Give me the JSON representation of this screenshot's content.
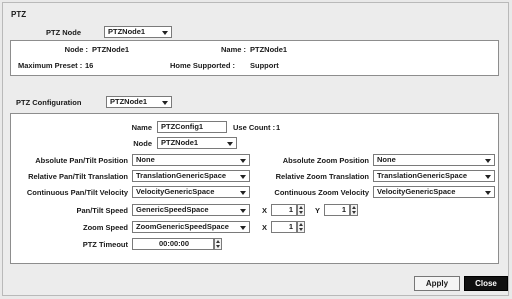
{
  "title": "PTZ",
  "node_select": {
    "label": "PTZ Node",
    "value": "PTZNode1"
  },
  "info": {
    "node_label": "Node :",
    "node_value": "PTZNode1",
    "name_label": "Name :",
    "name_value": "PTZNode1",
    "max_preset_label": "Maximum Preset :",
    "max_preset_value": "16",
    "home_label": "Home Supported :",
    "home_value": "Support"
  },
  "config_select": {
    "label": "PTZ Configuration",
    "value": "PTZNode1"
  },
  "config": {
    "name_label": "Name",
    "name_value": "PTZConfig1",
    "use_count_label": "Use Count :",
    "use_count_value": "1",
    "node_label": "Node",
    "node_value": "PTZNode1",
    "abs_pt_label": "Absolute Pan/Tilt Position",
    "abs_pt_value": "None",
    "abs_zoom_label": "Absolute Zoom Position",
    "abs_zoom_value": "None",
    "rel_pt_label": "Relative Pan/Tilt Translation",
    "rel_pt_value": "TranslationGenericSpace",
    "rel_zoom_label": "Relative Zoom Translation",
    "rel_zoom_value": "TranslationGenericSpace",
    "cont_pt_label": "Continuous Pan/Tilt Velocity",
    "cont_pt_value": "VelocityGenericSpace",
    "cont_zoom_label": "Continuous Zoom Velocity",
    "cont_zoom_value": "VelocityGenericSpace",
    "pt_speed_label": "Pan/Tilt Speed",
    "pt_speed_value": "GenericSpeedSpace",
    "pt_x_label": "X",
    "pt_x_value": "1",
    "pt_y_label": "Y",
    "pt_y_value": "1",
    "zoom_speed_label": "Zoom Speed",
    "zoom_speed_value": "ZoomGenericSpeedSpace",
    "zoom_x_label": "X",
    "zoom_x_value": "1",
    "timeout_label": "PTZ Timeout",
    "timeout_value": "00:00:00"
  },
  "buttons": {
    "apply": "Apply",
    "close": "Close"
  }
}
